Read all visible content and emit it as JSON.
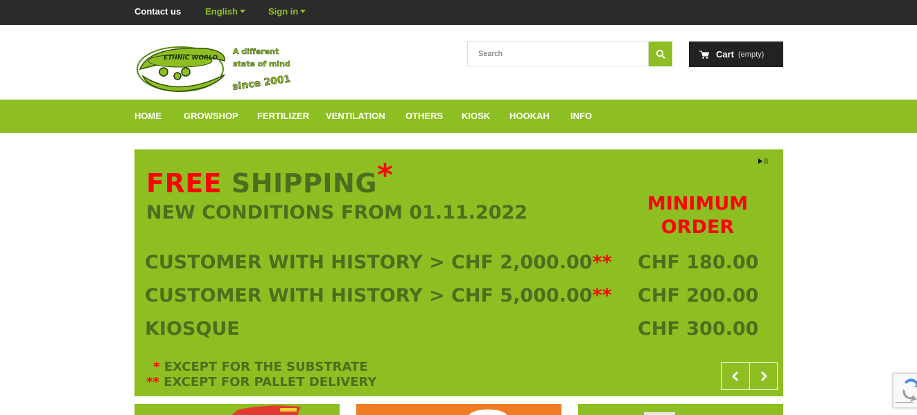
{
  "topbar": {
    "contact_label": "Contact us",
    "language_label": "English",
    "signin_label": "Sign in"
  },
  "logo": {
    "brand_text": "ETHNIC WORLD",
    "tagline_1": "A different",
    "tagline_2": "state of mind",
    "since_text": "since 2001"
  },
  "search": {
    "placeholder": "Search"
  },
  "cart": {
    "label": "Cart",
    "status": "(empty)"
  },
  "nav": {
    "items": [
      {
        "label": "HOME"
      },
      {
        "label": "GROWSHOP"
      },
      {
        "label": "FERTILIZER"
      },
      {
        "label": "VENTILATION"
      },
      {
        "label": "OTHERS"
      },
      {
        "label": "KIOSK"
      },
      {
        "label": "HOOKAH"
      },
      {
        "label": "INFO"
      }
    ]
  },
  "slide": {
    "free": "FREE",
    "shipping": "SHIPPING",
    "asterisk": "*",
    "conditions": "NEW CONDITIONS FROM 01.11.2022",
    "minimum_line1": "MINIMUM",
    "minimum_line2": "ORDER",
    "rows": [
      {
        "label": "CUSTOMER WITH HISTORY > CHF 2,000.00",
        "mark": "**",
        "price": "CHF 180.00"
      },
      {
        "label": "CUSTOMER WITH HISTORY > CHF 5,000.00",
        "mark": "**",
        "price": "CHF 200.00"
      },
      {
        "label": "KIOSQUE",
        "mark": "",
        "price": "CHF 300.00"
      }
    ],
    "footnotes": [
      {
        "mark": "*",
        "text": "EXCEPT FOR THE SUBSTRATE"
      },
      {
        "mark": "**",
        "text": "EXCEPT FOR PALLET DELIVERY"
      }
    ]
  },
  "colors": {
    "brand_green": "#8ebf22",
    "dark_green_text": "#4b6f1e",
    "accent_red": "#ff0000",
    "topbar_bg": "#2b2b2b",
    "cart_bg": "#222222",
    "tile_orange": "#f07c24"
  },
  "icons": {
    "search": "search-icon",
    "cart": "cart-icon",
    "prev": "chevron-left-icon",
    "next": "chevron-right-icon",
    "play_pause": "play-pause-icon"
  }
}
